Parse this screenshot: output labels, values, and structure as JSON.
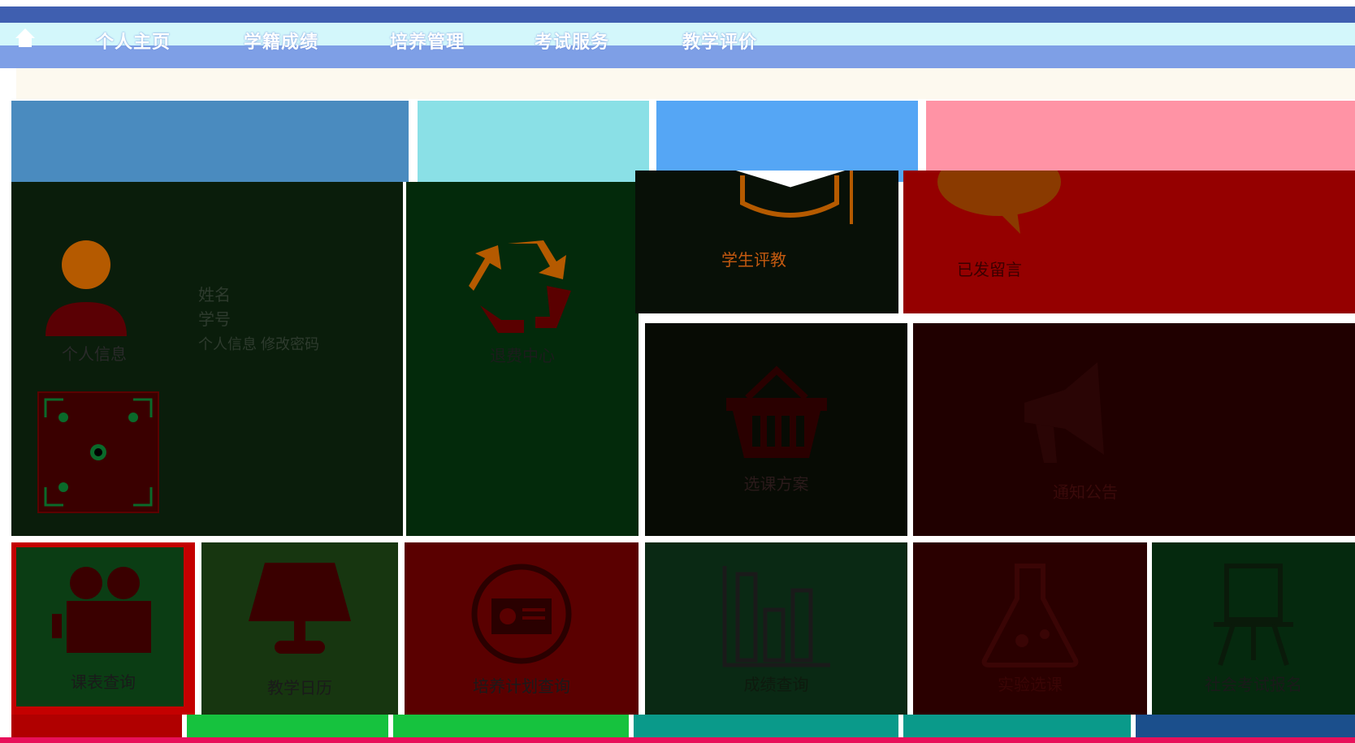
{
  "nav": {
    "home_icon": "home-icon",
    "items": [
      "个人主页",
      "学籍成绩",
      "培养管理",
      "考试服务",
      "教学评价"
    ]
  },
  "tiles": {
    "personal_info": {
      "label": "个人信息",
      "icon": "user-icon",
      "color": "#4a8bbf"
    },
    "student_info_panel": {
      "line1": "姓名",
      "line2": "学号",
      "line3": "个人信息 修改密码"
    },
    "qr_code": {
      "icon": "qr-code-icon"
    },
    "recycle_center": {
      "label": "退费中心",
      "icon": "recycle-icon",
      "color": "#8ae0e6"
    },
    "student_eval": {
      "label": "学生评教",
      "icon": "graduation-cap-icon",
      "color": "#55a6f5"
    },
    "messages": {
      "label": "已发留言",
      "icon": "speech-bubble-icon",
      "color": "#ff93a5"
    },
    "shopping": {
      "label": "选课方案",
      "icon": "basket-icon",
      "color": "#1a1a1a"
    },
    "announcements": {
      "label": "通知公告",
      "icon": "megaphone-icon",
      "color": "#2a0000"
    },
    "schedule": {
      "label": "课表查询",
      "icon": "projector-icon",
      "color": "#0b3d14"
    },
    "teaching_calendar": {
      "label": "教学日历",
      "icon": "lamp-icon",
      "color": "#173610"
    },
    "plan_query": {
      "label": "培养计划查询",
      "icon": "radio-icon",
      "color": "#5a0000"
    },
    "grade_report": {
      "label": "成绩查询",
      "icon": "bar-chart-icon",
      "color": "#0a2914"
    },
    "lab": {
      "label": "实验选课",
      "icon": "flask-icon",
      "color": "#2a0000"
    },
    "social_exam": {
      "label": "社会考试报名",
      "icon": "easel-icon",
      "color": "#05290e"
    }
  },
  "colors": {
    "nav_top": "#3f5fb0",
    "nav_mid": "#d3f7fb",
    "nav_bottom": "#7e9fe6",
    "strip_green": "#16c23e",
    "strip_teal": "#0a9a8a",
    "strip_blue": "#1b4f8c"
  }
}
